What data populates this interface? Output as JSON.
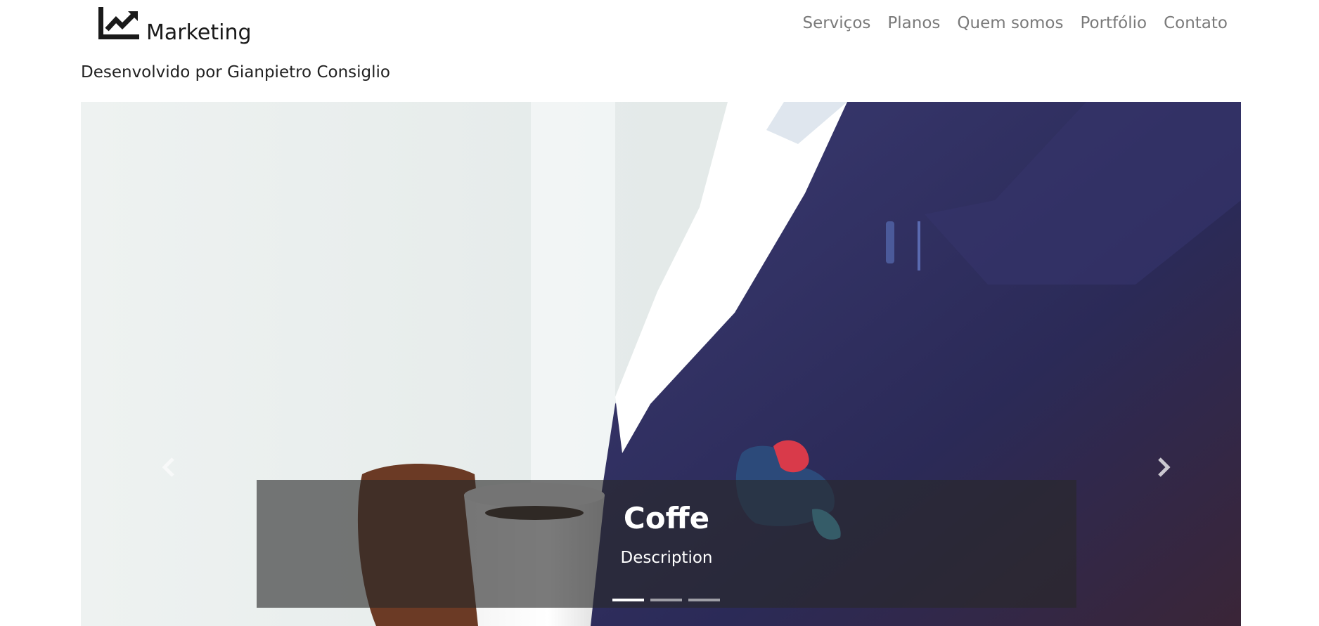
{
  "brand": {
    "name": "Marketing",
    "icon": "trending-up-chart-icon"
  },
  "nav": {
    "items": [
      {
        "label": "Serviços"
      },
      {
        "label": "Planos"
      },
      {
        "label": "Quem somos"
      },
      {
        "label": "Portfólio"
      },
      {
        "label": "Contato"
      }
    ]
  },
  "credit": "Desenvolvido por Gianpietro Consiglio",
  "carousel": {
    "active_index": 0,
    "slide": {
      "title": "Coffe",
      "description": "Description",
      "image": "man-in-suit-holding-coffee-cup-photo"
    },
    "prev_icon": "chevron-left-icon",
    "next_icon": "chevron-right-icon",
    "indicator_count": 3
  },
  "colors": {
    "nav_text": "#7a7a7a",
    "brand_text": "#1a1a1a",
    "caption_bg": "#282828",
    "suit": "#2e2d5e"
  }
}
